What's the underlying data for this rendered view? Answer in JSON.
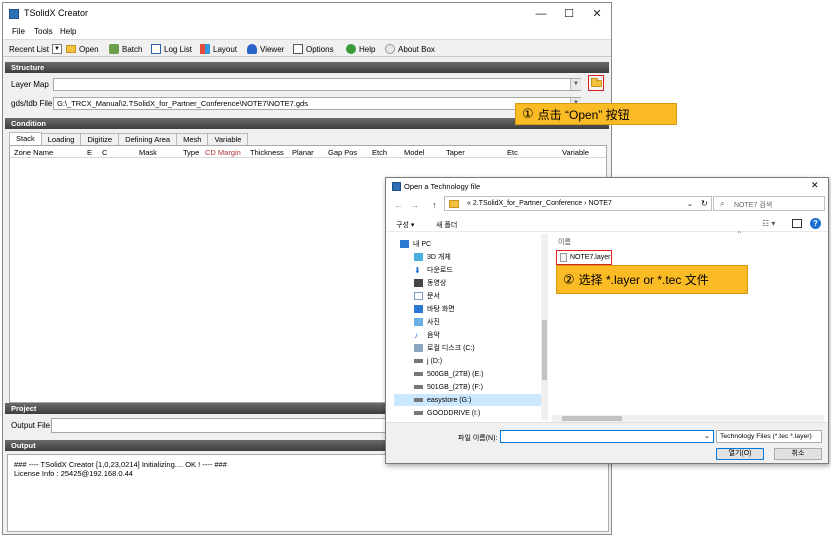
{
  "main_window": {
    "title": "TSolidX Creator",
    "controls": {
      "minimize": "—",
      "maximize": "☐",
      "close": "✕"
    },
    "menu": [
      "File",
      "Tools",
      "Help"
    ],
    "toolbar": {
      "recent_list": "Recent List",
      "open": "Open",
      "batch": "Batch",
      "log_list": "Log List",
      "layout": "Layout",
      "viewer": "Viewer",
      "options": "Options",
      "help": "Help",
      "about": "About Box"
    },
    "structure": {
      "header": "Structure",
      "layer_map_label": "Layer Map",
      "layer_map_value": "",
      "gds_label": "gds/tdb File",
      "gds_value": "G:\\_TRCX_Manual\\2.TSolidX_for_Partner_Conference\\NOTE7\\NOTE7.gds"
    },
    "condition": {
      "header": "Condition",
      "tabs": [
        "Stack",
        "Loading",
        "Digitize",
        "Defining Area",
        "Mesh",
        "Variable"
      ],
      "active_tab": "Stack",
      "columns": [
        "Zone Name",
        "E",
        "C",
        "Mask",
        "Type",
        "CD Margin",
        "Thickness",
        "Planar",
        "Gap Pos",
        "Etch",
        "Model",
        "Taper",
        "Etc",
        "Variable"
      ]
    },
    "project": {
      "header": "Project",
      "output_file_label": "Output File"
    },
    "output": {
      "header": "Output",
      "lines": [
        "### ---- TSolidX Creator [1,0,23,0214] Initializing.... OK ! ---- ###",
        "License Info : 25425@192.168.0.44"
      ]
    }
  },
  "callouts": {
    "step1": {
      "num": "①",
      "text": "点击 “Open” 按钮"
    },
    "step2": {
      "num": "②",
      "text": "选择 *.layer or *.tec 文件"
    }
  },
  "dialog": {
    "title": "Open a Technology file",
    "nav": {
      "back": "←",
      "forward": "→",
      "up": "↑"
    },
    "address": {
      "prefix": "«",
      "path": [
        "2.TSolidX_for_Partner_Conference",
        "NOTE7"
      ],
      "sep": "›"
    },
    "search_placeholder": "NOTE7 검색",
    "organize": "구성 ▾",
    "new_folder": "새 폴더",
    "nav_items": [
      {
        "label": "내 PC",
        "icon": "pc-icon"
      },
      {
        "label": "3D 개체",
        "icon": "cube-icon"
      },
      {
        "label": "다운로드",
        "icon": "download-icon"
      },
      {
        "label": "동영상",
        "icon": "video-icon"
      },
      {
        "label": "문서",
        "icon": "document-icon"
      },
      {
        "label": "바탕 화면",
        "icon": "desktop-icon"
      },
      {
        "label": "사진",
        "icon": "pictures-icon"
      },
      {
        "label": "음악",
        "icon": "music-icon"
      },
      {
        "label": "로컬 디스크 (C:)",
        "icon": "drive-icon"
      },
      {
        "label": "j (D:)",
        "icon": "drive-icon"
      },
      {
        "label": "500GB_(2TB) (E:)",
        "icon": "drive-icon"
      },
      {
        "label": "501GB_(2TB) (F:)",
        "icon": "drive-icon"
      },
      {
        "label": "easystore (G:)",
        "icon": "drive-icon"
      },
      {
        "label": "GOODDRIVE (I:)",
        "icon": "drive-icon"
      }
    ],
    "selected_nav": "easystore (G:)",
    "column_name": "이름",
    "files": [
      "NOTE7.layer"
    ],
    "filename_label": "파일 이름(N):",
    "filename_value": "",
    "filetype": "Technology Files (*.tec *.layer)",
    "open_button": "열기(O)",
    "cancel_button": "취소"
  },
  "colors": {
    "accent_red": "#e02020",
    "callout_yellow": "#fbbb25",
    "header_dark": "#4a4a4a",
    "selection_blue": "#cce8ff"
  }
}
